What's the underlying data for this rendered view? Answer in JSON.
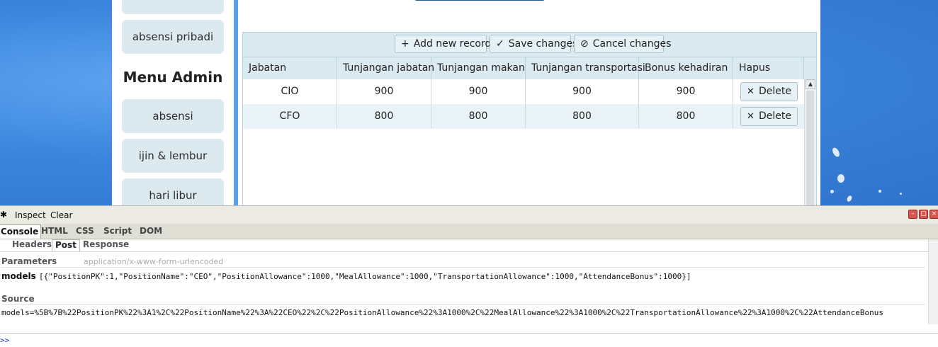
{
  "sidebar": {
    "items_top": [
      {
        "label": ""
      },
      {
        "label": "absensi pribadi"
      }
    ],
    "admin_title": "Menu Admin",
    "admin_items": [
      {
        "label": "absensi"
      },
      {
        "label": "ijin & lembur"
      },
      {
        "label": "hari libur"
      }
    ]
  },
  "grid": {
    "toolbar": {
      "add": "Add new record",
      "save": "Save changes",
      "cancel": "Cancel changes"
    },
    "columns": [
      "Jabatan",
      "Tunjangan jabatan",
      "Tunjangan makan",
      "Tunjangan transportasi",
      "Bonus kehadiran",
      "Hapus"
    ],
    "rows": [
      {
        "jabatan": "CIO",
        "tunj_jabatan": "900",
        "tunj_makan": "900",
        "tunj_transport": "900",
        "bonus": "900",
        "delete": "Delete"
      },
      {
        "jabatan": "CFO",
        "tunj_jabatan": "800",
        "tunj_makan": "800",
        "tunj_transport": "800",
        "bonus": "800",
        "delete": "Delete"
      }
    ]
  },
  "firebug": {
    "toolbar": {
      "inspect": "Inspect",
      "clear": "Clear"
    },
    "tabs": [
      "Console",
      "HTML",
      "CSS",
      "Script",
      "DOM"
    ],
    "subtabs": [
      "Headers",
      "Post",
      "Response"
    ],
    "params_label": "Parameters",
    "params_hint": "application/x-www-form-urlencoded",
    "param_name": "models",
    "param_value": "[{\"PositionPK\":1,\"PositionName\":\"CEO\",\"PositionAllowance\":1000,\"MealAllowance\":1000,\"TransportationAllowance\":1000,\"AttendanceBonus\":1000}]",
    "source_label": "Source",
    "source_value": "models=%5B%7B%22PositionPK%22%3A1%2C%22PositionName%22%3A%22CEO%22%2C%22PositionAllowance%22%3A1000%2C%22MealAllowance%22%3A1000%2C%22TransportationAllowance%22%3A1000%2C%22AttendanceBonus",
    "prompt": ">>"
  },
  "colors": {
    "accent_bg": "#dbeaf0",
    "desktop_blue": "#3b84dc",
    "divider_blue": "#5aa1e8"
  }
}
